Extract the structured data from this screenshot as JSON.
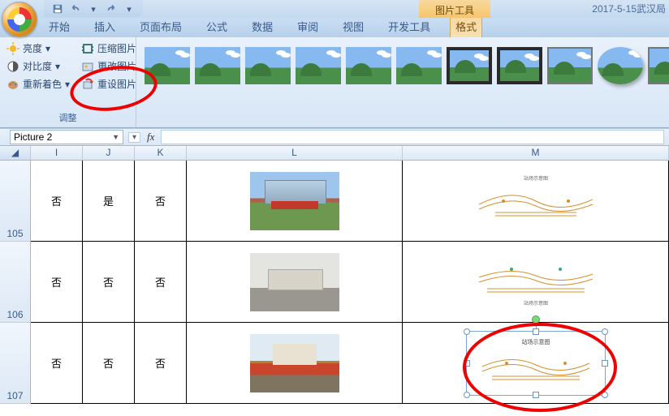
{
  "qat": {
    "save": "保存",
    "undo": "撤销",
    "redo": "恢复"
  },
  "context_tab_title": "图片工具",
  "document_title": "2017-5-15武汉局",
  "tabs": {
    "home": "开始",
    "insert": "插入",
    "page_layout": "页面布局",
    "formulas": "公式",
    "data": "数据",
    "review": "审阅",
    "view": "视图",
    "developer": "开发工具",
    "format": "格式"
  },
  "ribbon": {
    "adjust": {
      "brightness": "亮度",
      "contrast": "对比度",
      "recolor": "重新着色",
      "compress": "压缩图片",
      "change": "更改图片",
      "reset": "重设图片",
      "group_label": "调整"
    }
  },
  "namebox": {
    "value": "Picture 2"
  },
  "fx_label": "fx",
  "columns": {
    "I": "I",
    "J": "J",
    "K": "K",
    "L": "L",
    "M": "M"
  },
  "rows": {
    "105": {
      "num": "105",
      "I": "否",
      "J": "是",
      "K": "否"
    },
    "106": {
      "num": "106",
      "I": "否",
      "J": "否",
      "K": "否"
    },
    "107": {
      "num": "107",
      "I": "否",
      "J": "否",
      "K": "否"
    }
  }
}
